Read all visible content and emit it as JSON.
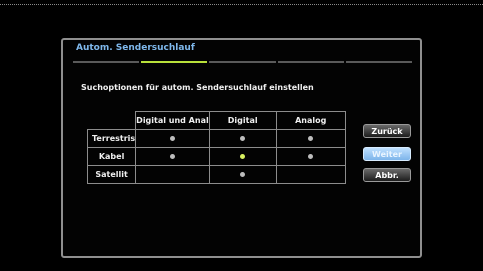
{
  "dialog": {
    "title": "Autom. Sendersuchlauf",
    "subtitle": "Suchoptionen für autom. Sendersuchlauf einstellen",
    "progress": {
      "steps": 5,
      "current_step": 2
    }
  },
  "grid": {
    "columns": [
      "Digital und Anal",
      "Digital",
      "Analog"
    ],
    "rows": [
      {
        "label": "Terrestris",
        "cells": [
          "dot",
          "dot",
          "dot"
        ]
      },
      {
        "label": "Kabel",
        "cells": [
          "dot",
          "dot-active",
          "dot"
        ]
      },
      {
        "label": "Satellit",
        "cells": [
          "",
          "dot",
          ""
        ]
      }
    ]
  },
  "buttons": {
    "back_label": "Zurück",
    "next_label": "Weiter",
    "cancel_label": "Abbr."
  },
  "colors": {
    "title_accent": "#7fb8ec",
    "progress_active": "#b8e03a",
    "focused_button": "#9ccaf5",
    "active_dot": "#d8f060"
  }
}
